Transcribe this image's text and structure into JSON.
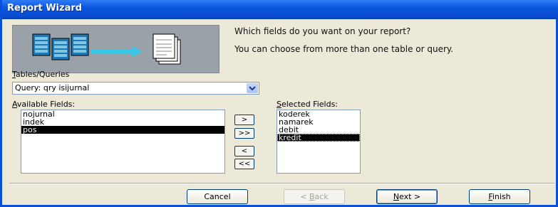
{
  "window": {
    "title": "Report Wizard"
  },
  "graphic": {
    "name": "report-wizard-graphic"
  },
  "prompt": {
    "question": "Which fields do you want on your report?",
    "hint": "You can choose from more than one table or query."
  },
  "tables_queries": {
    "label_mnemonic": "T",
    "label_rest": "ables/Queries",
    "value": "Query: qry isijurnal"
  },
  "available_fields": {
    "label_mnemonic": "A",
    "label_rest": "vailable Fields:",
    "items": [
      "nojurnal",
      "indek",
      "pos"
    ],
    "selected_index": 2
  },
  "selected_fields": {
    "label_mnemonic": "S",
    "label_rest": "elected Fields:",
    "items": [
      "koderek",
      "namarek",
      "debit",
      "kredit"
    ],
    "selected_index": 3
  },
  "move_buttons": {
    "add_one": ">",
    "add_all": ">>",
    "remove_one": "<",
    "remove_all": "<<"
  },
  "footer": {
    "cancel": "Cancel",
    "back_mnemonic": "B",
    "back_pre": "< ",
    "back_post": "ack",
    "next_mnemonic": "N",
    "next_post": "ext >",
    "finish_mnemonic": "F",
    "finish_post": "inish"
  },
  "colors": {
    "titlebar": "#0a56e0",
    "selection": "#000000",
    "dialog_bg": "#ece9d8",
    "arrow": "#35c6e8"
  }
}
